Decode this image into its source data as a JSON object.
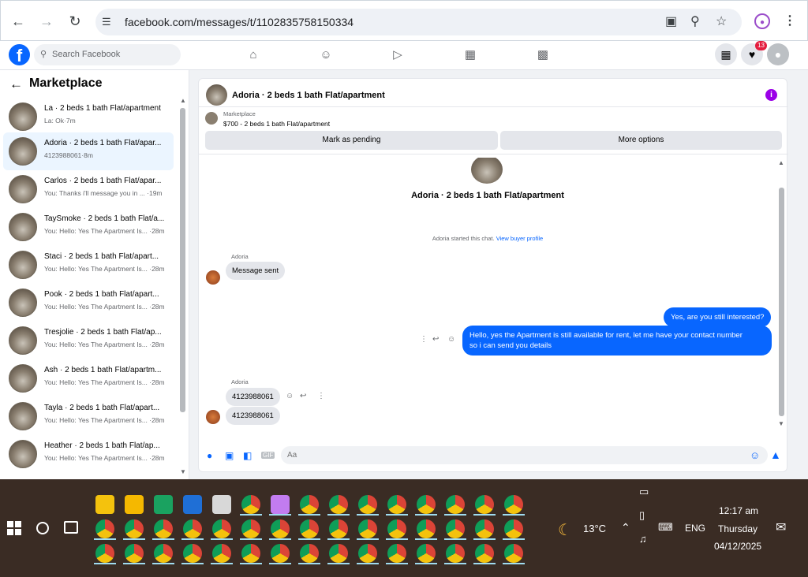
{
  "browser": {
    "url": "facebook.com/messages/t/1102835758150334",
    "back_icon": "arrow-left-icon",
    "forward_icon": "arrow-right-icon",
    "reload_icon": "reload-icon"
  },
  "fb": {
    "logo": "f",
    "search_placeholder": "Search Facebook",
    "notification_count": "13"
  },
  "sidebar": {
    "title": "Marketplace",
    "conversations": [
      {
        "name": "La · 2 beds 1 bath Flat/apartment",
        "preview": "La: Ok·7m"
      },
      {
        "name": "Adoria · 2 beds 1 bath Flat/apar...",
        "preview": "4123988061·8m"
      },
      {
        "name": "Carlos · 2 beds 1 bath Flat/apar...",
        "preview": "You: Thanks i'll message you in ... ·19m"
      },
      {
        "name": "TaySmoke · 2 beds 1 bath Flat/a...",
        "preview": "You: Hello: Yes The Apartment Is... ·28m"
      },
      {
        "name": "Staci · 2 beds 1 bath Flat/apart...",
        "preview": "You: Hello: Yes The Apartment Is... ·28m"
      },
      {
        "name": "Pook · 2 beds 1 bath Flat/apart...",
        "preview": "You: Hello: Yes The Apartment Is... ·28m"
      },
      {
        "name": "Tresjolie · 2 beds 1 bath Flat/ap...",
        "preview": "You: Hello: Yes The Apartment Is... ·28m"
      },
      {
        "name": "Ash · 2 beds 1 bath Flat/apartm...",
        "preview": "You: Hello: Yes The Apartment Is... ·28m"
      },
      {
        "name": "Tayla · 2 beds 1 bath Flat/apart...",
        "preview": "You: Hello: Yes The Apartment Is... ·28m"
      },
      {
        "name": "Heather · 2 beds 1 bath Flat/ap...",
        "preview": "You: Hello: Yes The Apartment Is... ·28m"
      }
    ]
  },
  "chat": {
    "title": "Adoria · 2 beds 1 bath Flat/apartment",
    "listing_label": "Marketplace",
    "listing_price": "$700 - 2 beds 1 bath Flat/apartment",
    "mark_pending": "Mark as pending",
    "more_options": "More options",
    "thread_title": "Adoria · 2 beds 1 bath Flat/apartment",
    "started_text": "Adoria started this chat.",
    "view_profile": "View buyer profile",
    "sender_name": "Adoria",
    "msg_1": "Message sent",
    "msg_2": "Yes, are you still interested?",
    "msg_3_line1": "Hello, yes the Apartment is still available for rent, let me have your contact number",
    "msg_3_line2": "so i can send you details",
    "sender_name_2": "Adoria",
    "msg_4": "4123988061",
    "msg_5": "4123988061",
    "input_placeholder": "Aa"
  },
  "taskbar": {
    "weather": "13°C",
    "language": "ENG",
    "time": "12:17 am",
    "day": "Thursday",
    "date": "04/12/2025"
  }
}
